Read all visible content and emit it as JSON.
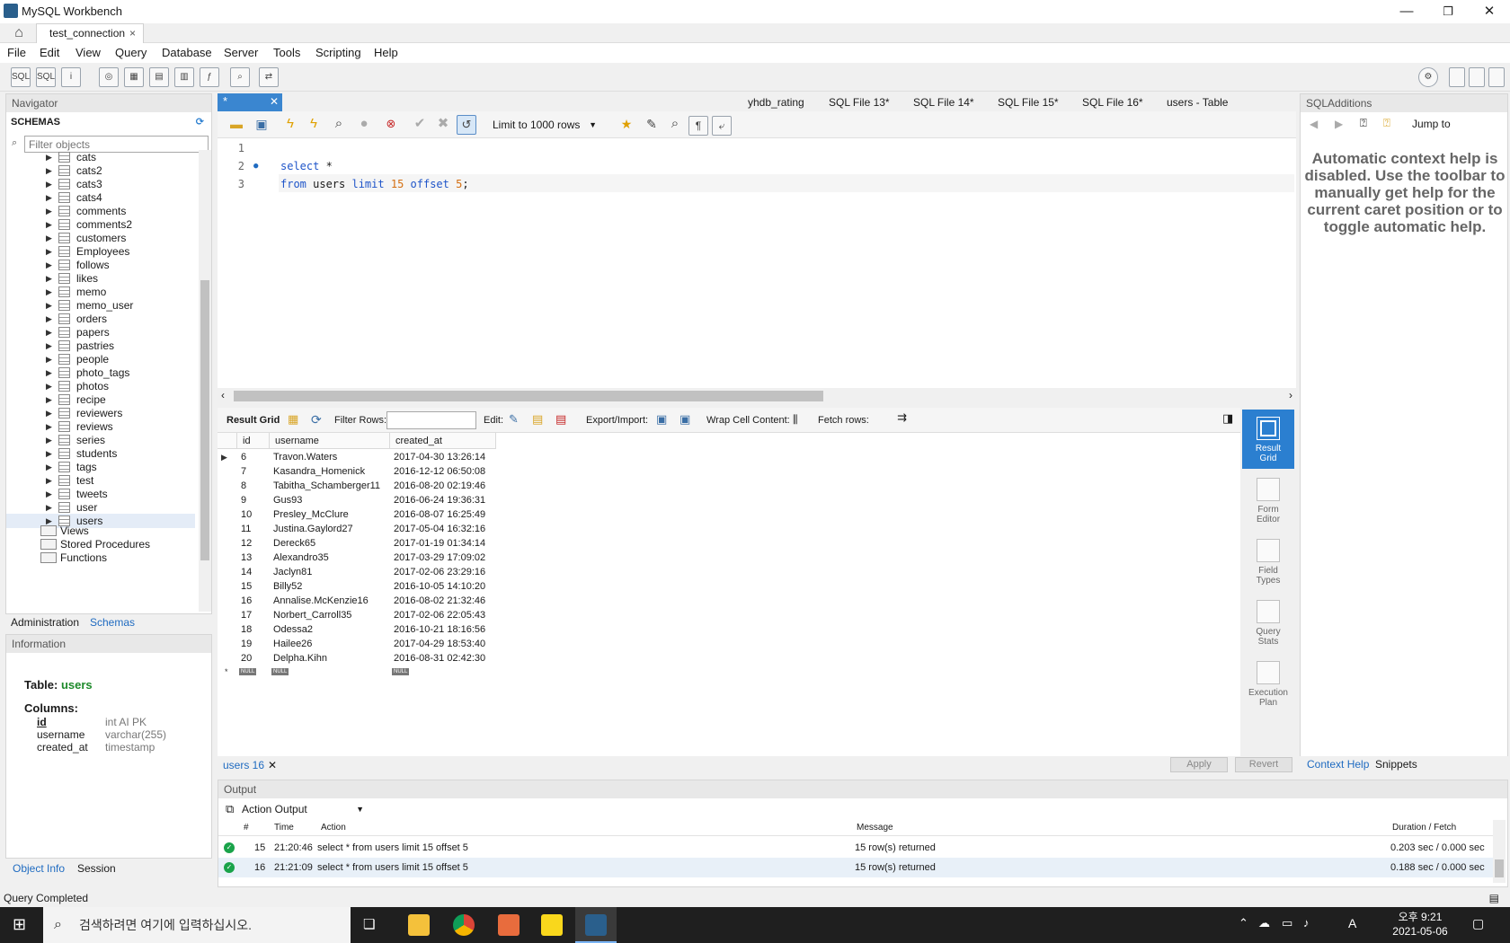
{
  "window": {
    "title": "MySQL Workbench",
    "minimize": "—",
    "maximize": "❐",
    "close": "✕"
  },
  "connection_tab": {
    "label": "test_connection",
    "close": "×"
  },
  "menu": [
    "File",
    "Edit",
    "View",
    "Query",
    "Database",
    "Server",
    "Tools",
    "Scripting",
    "Help"
  ],
  "navigator": {
    "title": "Navigator",
    "schemas_label": "SCHEMAS",
    "filter_placeholder": "Filter objects",
    "tables": [
      "cats",
      "cats2",
      "cats3",
      "cats4",
      "comments",
      "comments2",
      "customers",
      "Employees",
      "follows",
      "likes",
      "memo",
      "memo_user",
      "orders",
      "papers",
      "pastries",
      "people",
      "photo_tags",
      "photos",
      "recipe",
      "reviewers",
      "reviews",
      "series",
      "students",
      "tags",
      "test",
      "tweets",
      "user",
      "users"
    ],
    "selected_table": "users",
    "sub_nodes": [
      "Views",
      "Stored Procedures",
      "Functions"
    ],
    "tabs": [
      "Administration",
      "Schemas"
    ],
    "active_tab": "Schemas"
  },
  "information": {
    "title": "Information",
    "table_label": "Table:",
    "table_name": "users",
    "columns_label": "Columns:",
    "columns": [
      {
        "name": "id",
        "type": "int AI PK"
      },
      {
        "name": "username",
        "type": "varchar(255)"
      },
      {
        "name": "created_at",
        "type": "timestamp"
      }
    ],
    "tabs": [
      "Object Info",
      "Session"
    ]
  },
  "editor": {
    "active_tab": "*",
    "tabs": [
      "yhdb_rating",
      "SQL File 13*",
      "SQL File 14*",
      "SQL File 15*",
      "SQL File 16*",
      "users - Table"
    ],
    "limit": "Limit to 1000 rows",
    "lines": [
      "1",
      "2",
      "3"
    ],
    "code": {
      "l2_kw": "select",
      "l2_rest": " *",
      "l3_kw1": "from",
      "l3_t1": " users ",
      "l3_kw2": "limit",
      "l3_n1": "15",
      "l3_kw3": "offset",
      "l3_n2": "5",
      "l3_end": ";"
    }
  },
  "result": {
    "toolbar": {
      "result_grid": "Result Grid",
      "filter_rows": "Filter Rows:",
      "edit": "Edit:",
      "export_import": "Export/Import:",
      "wrap": "Wrap Cell Content:",
      "fetch_rows": "Fetch rows:"
    },
    "columns": [
      "id",
      "username",
      "created_at"
    ],
    "rows": [
      [
        "6",
        "Travon.Waters",
        "2017-04-30 13:26:14"
      ],
      [
        "7",
        "Kasandra_Homenick",
        "2016-12-12 06:50:08"
      ],
      [
        "8",
        "Tabitha_Schamberger11",
        "2016-08-20 02:19:46"
      ],
      [
        "9",
        "Gus93",
        "2016-06-24 19:36:31"
      ],
      [
        "10",
        "Presley_McClure",
        "2016-08-07 16:25:49"
      ],
      [
        "11",
        "Justina.Gaylord27",
        "2017-05-04 16:32:16"
      ],
      [
        "12",
        "Dereck65",
        "2017-01-19 01:34:14"
      ],
      [
        "13",
        "Alexandro35",
        "2017-03-29 17:09:02"
      ],
      [
        "14",
        "Jaclyn81",
        "2017-02-06 23:29:16"
      ],
      [
        "15",
        "Billy52",
        "2016-10-05 14:10:20"
      ],
      [
        "16",
        "Annalise.McKenzie16",
        "2016-08-02 21:32:46"
      ],
      [
        "17",
        "Norbert_Carroll35",
        "2017-02-06 22:05:43"
      ],
      [
        "18",
        "Odessa2",
        "2016-10-21 18:16:56"
      ],
      [
        "19",
        "Hailee26",
        "2017-04-29 18:53:40"
      ],
      [
        "20",
        "Delpha.Kihn",
        "2016-08-31 02:42:30"
      ]
    ],
    "null_label": "NULL",
    "side_buttons": [
      {
        "l1": "Result",
        "l2": "Grid"
      },
      {
        "l1": "Form",
        "l2": "Editor"
      },
      {
        "l1": "Field",
        "l2": "Types"
      },
      {
        "l1": "Query",
        "l2": "Stats"
      },
      {
        "l1": "Execution",
        "l2": "Plan"
      }
    ],
    "tab_label": "users 16",
    "apply": "Apply",
    "revert": "Revert"
  },
  "output": {
    "title": "Output",
    "selector": "Action Output",
    "headers": [
      "#",
      "Time",
      "Action",
      "Message",
      "Duration / Fetch"
    ],
    "rows": [
      {
        "n": "15",
        "time": "21:20:46",
        "action": "select * from users limit 15 offset 5",
        "message": "15 row(s) returned",
        "duration": "0.203 sec / 0.000 sec"
      },
      {
        "n": "16",
        "time": "21:21:09",
        "action": "select * from users limit 15 offset 5",
        "message": "15 row(s) returned",
        "duration": "0.188 sec / 0.000 sec"
      }
    ]
  },
  "sql_additions": {
    "title": "SQLAdditions",
    "jump_to": "Jump to",
    "help_text": "Automatic context help is disabled. Use the toolbar to manually get help for the current caret position or to toggle automatic help.",
    "tabs": [
      "Context Help",
      "Snippets"
    ]
  },
  "status": "Query Completed",
  "taskbar": {
    "search_placeholder": "검색하려면 여기에 입력하십시오.",
    "time": "오후 9:21",
    "date": "2021-05-06",
    "ime": "A"
  },
  "colors": {
    "accent": "#2b7fd0",
    "ok": "#1aa34a",
    "keyword": "#1f55c9",
    "number": "#d46f12"
  }
}
